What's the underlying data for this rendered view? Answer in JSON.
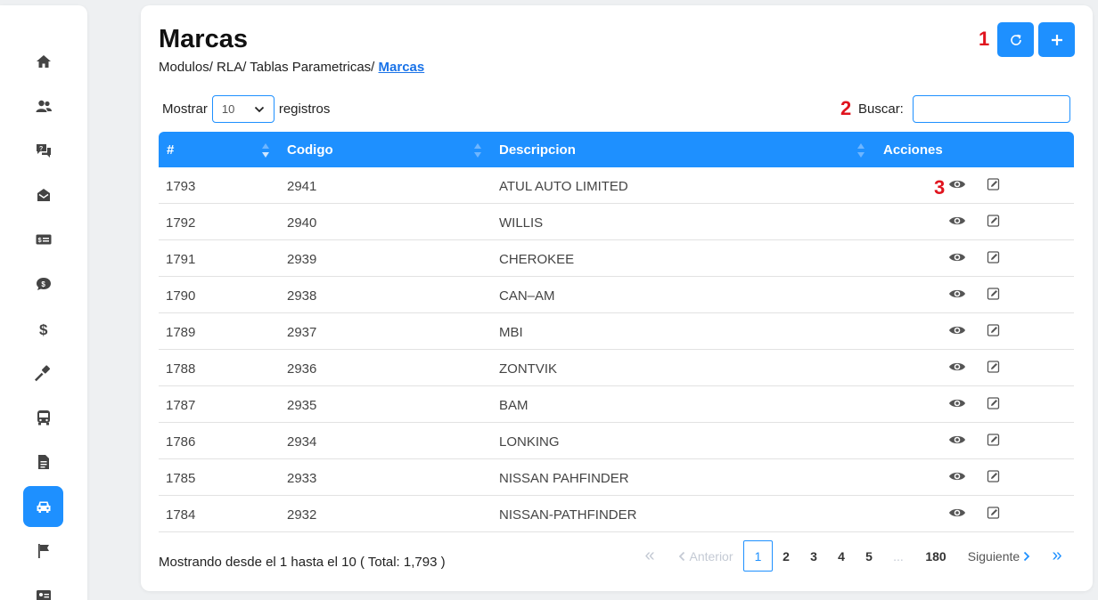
{
  "sidebar": {
    "items": [
      {
        "icon": "home-icon"
      },
      {
        "icon": "users-icon"
      },
      {
        "icon": "chat-question-icon"
      },
      {
        "icon": "mail-box-icon"
      },
      {
        "icon": "money-card-icon"
      },
      {
        "icon": "money-bubble-icon"
      },
      {
        "icon": "dollar-icon"
      },
      {
        "icon": "gavel-icon"
      },
      {
        "icon": "bus-icon"
      },
      {
        "icon": "document-icon"
      },
      {
        "icon": "car-icon"
      },
      {
        "icon": "flag-icon"
      },
      {
        "icon": "id-card-icon"
      }
    ],
    "active_index": 10
  },
  "header": {
    "title": "Marcas",
    "breadcrumb_prefix": "Modulos/ RLA/ Tablas Parametricas/",
    "breadcrumb_current": "Marcas"
  },
  "annotations": {
    "one": "1",
    "two": "2",
    "three": "3"
  },
  "controls": {
    "show_label": "Mostrar",
    "page_size": "10",
    "records_label": "registros",
    "search_label": "Buscar:",
    "search_value": ""
  },
  "table": {
    "columns": [
      "#",
      "Codigo",
      "Descripcion",
      "Acciones"
    ],
    "rows": [
      {
        "id": "1793",
        "codigo": "2941",
        "descripcion": "ATUL AUTO LIMITED"
      },
      {
        "id": "1792",
        "codigo": "2940",
        "descripcion": "WILLIS"
      },
      {
        "id": "1791",
        "codigo": "2939",
        "descripcion": "CHEROKEE"
      },
      {
        "id": "1790",
        "codigo": "2938",
        "descripcion": "CAN–AM"
      },
      {
        "id": "1789",
        "codigo": "2937",
        "descripcion": "MBI"
      },
      {
        "id": "1788",
        "codigo": "2936",
        "descripcion": "ZONTVIK"
      },
      {
        "id": "1787",
        "codigo": "2935",
        "descripcion": "BAM"
      },
      {
        "id": "1786",
        "codigo": "2934",
        "descripcion": "LONKING"
      },
      {
        "id": "1785",
        "codigo": "2933",
        "descripcion": "NISSAN PAHFINDER"
      },
      {
        "id": "1784",
        "codigo": "2932",
        "descripcion": "NISSAN-PATHFINDER"
      }
    ]
  },
  "footer": {
    "info": "Mostrando desde el 1 hasta el 10 ( Total: 1,793 )",
    "pagination": {
      "first": "«",
      "prev": "Anterior",
      "pages": [
        "1",
        "2",
        "3",
        "4",
        "5",
        "...",
        "180"
      ],
      "current": "1",
      "next": "Siguiente",
      "last": "»"
    }
  },
  "colors": {
    "accent": "#1e90ff",
    "annotation": "#e0141e"
  }
}
